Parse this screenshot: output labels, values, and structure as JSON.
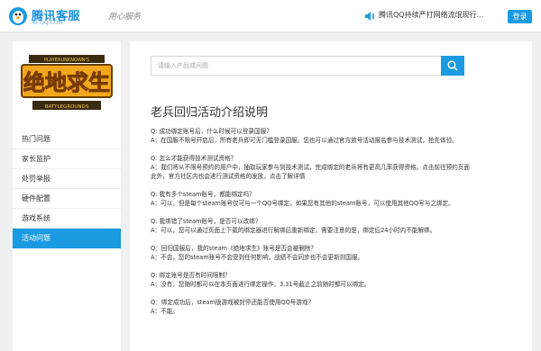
{
  "header": {
    "logo_title": "腾讯客服",
    "logo_sub": "KF.QQ.COM",
    "slogan": "用心服务",
    "notice": "腾讯QQ持续严打网络流氓现行…",
    "login_label": "登录",
    "brand_color": "#1a9ae0"
  },
  "sidebar": {
    "banner_top": "PLAYERUNKNOWN'S",
    "banner_title": "绝地求生",
    "banner_bottom": "BATTLEGROUNDS",
    "items": [
      {
        "label": "热门问题",
        "active": false
      },
      {
        "label": "家长监护",
        "active": false
      },
      {
        "label": "处罚举报",
        "active": false
      },
      {
        "label": "硬件配置",
        "active": false
      },
      {
        "label": "游戏系统",
        "active": false
      },
      {
        "label": "活动问题",
        "active": true
      }
    ]
  },
  "main": {
    "search_placeholder": "请输入产品或问题",
    "title": "老兵回归活动介绍说明",
    "qa": [
      {
        "lines": [
          "Q: 成功绑定账号后，什么时候可以登录国服？",
          "A：在国服不限号开启后，所有老兵即可无门槛登录国服。您也可以通过官方放号活动报名参与技术测试，抢先体验。"
        ]
      },
      {
        "lines": [
          "Q: 怎么才能获得技术测试资格？",
          "A：我们将从不限号预约的用户中，抽取玩家参与到技术测试，完成绑定的老兵将有更高几率获得资格。点击前往预约页面",
          "此外，官方社区内也会进行测试资格的发放，点击了解详情"
        ]
      },
      {
        "lines": [
          "Q: 我有多个steam账号，都能绑定吗？",
          "A：可以，但是每个steam账号仅可与一个QQ号绑定，如果您有其他的steam账号，可以使用其他QQ号与之绑定。"
        ]
      },
      {
        "lines": [
          "Q: 我绑错了steam账号，是否可以改绑？",
          "A：可以，您可以通过页面上下载的绑定器进行解绑后重新绑定，需要注意的是，绑定后24小时内不能解绑。"
        ]
      },
      {
        "lines": [
          "Q：回归国服后，我的steam《绝地求生》账号是否会被删除？",
          "A：不会，您的steam账号不会受到任何影响，战绩不会同步也不会更新到国服。"
        ]
      },
      {
        "lines": [
          "Q: 绑定账号是否有时间限制？",
          "A：没有，您随时都可以在本页面进行绑定操作，3.31号截止之前随时都可以绑定。"
        ]
      },
      {
        "lines": [
          "Q：绑定成功后，steam版游戏被封停还能否使用QQ号游戏？",
          "A：不能。"
        ]
      }
    ]
  }
}
